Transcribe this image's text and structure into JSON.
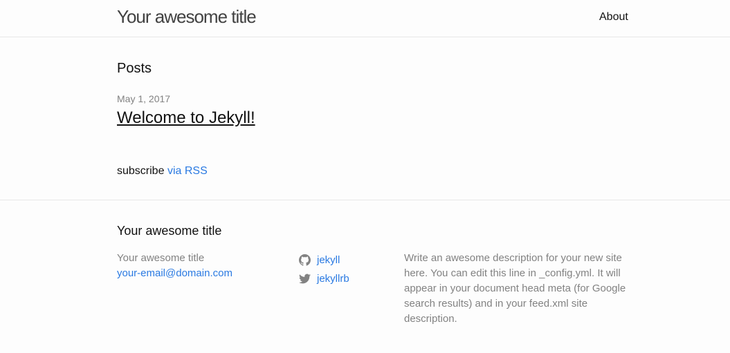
{
  "header": {
    "site_title": "Your awesome title",
    "nav": [
      {
        "label": "About"
      }
    ]
  },
  "main": {
    "page_heading": "Posts",
    "posts": [
      {
        "date": "May 1, 2017",
        "title": "Welcome to Jekyll!"
      }
    ],
    "rss": {
      "prefix": "subscribe",
      "link_label": "via RSS"
    }
  },
  "footer": {
    "heading": "Your awesome title",
    "contact": {
      "name": "Your awesome title",
      "email": "your-email@domain.com"
    },
    "social": [
      {
        "icon": "github-icon",
        "label": "jekyll"
      },
      {
        "icon": "twitter-icon",
        "label": "jekyllrb"
      }
    ],
    "description": "Write an awesome description for your new site here. You can edit this line in _config.yml. It will appear in your document head meta (for Google search results) and in your feed.xml site description."
  },
  "colors": {
    "background": "#fdfdfd",
    "text": "#111111",
    "muted": "#828282",
    "link": "#2a7ae2",
    "border": "#e8e8e8"
  }
}
